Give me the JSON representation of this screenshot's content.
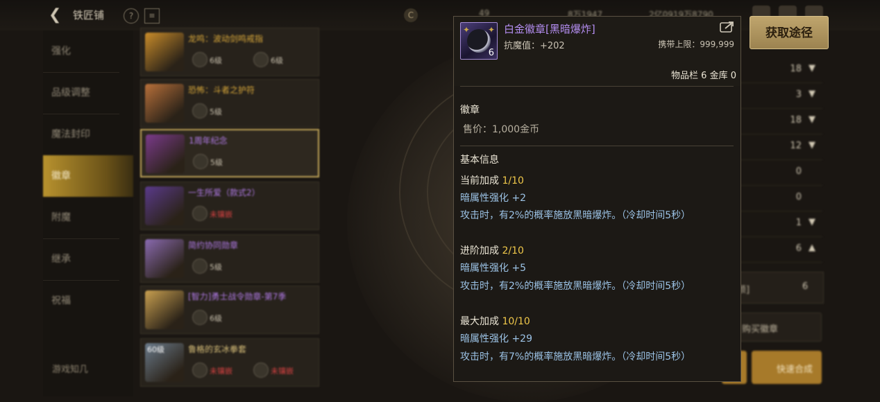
{
  "topbar": {
    "title": "铁匠铺",
    "resources": [
      "49",
      "8万1947",
      "2亿0919万8790"
    ]
  },
  "nav": {
    "items": [
      "强化",
      "品级调整",
      "魔法封印",
      "徽章",
      "附魔",
      "继承",
      "祝福"
    ],
    "active_index": 3,
    "footer_label": "游戏知几"
  },
  "items": [
    {
      "name": "龙鸣：波动剑鸣戒指",
      "badges": [
        "6级",
        "6级"
      ],
      "name_color": "#d9a83a",
      "thumb": "#c98c2a"
    },
    {
      "name": "恐怖：斗者之护符",
      "badges": [
        "5级"
      ],
      "name_color": "#d9a83a",
      "thumb": "#b8703a"
    },
    {
      "name": "1周年纪念",
      "badges": [
        "5级"
      ],
      "name_color": "#b07ae6",
      "thumb": "#7a3a8a"
    },
    {
      "name": "一生所爱（款式2）",
      "badges": [
        "未镶嵌"
      ],
      "name_color": "#b07ae6",
      "thumb": "#5a3a8a"
    },
    {
      "name": "简约协同勋章",
      "badges": [
        "5级"
      ],
      "name_color": "#b07ae6",
      "thumb": "#8a6ab0"
    },
    {
      "name": "[智力]勇士战令勋章-第7季",
      "badges": [
        "6级"
      ],
      "name_color": "#b07ae6",
      "thumb": "#c9a050"
    },
    {
      "name": "鲁格的玄冰拳套",
      "badges": [
        "未镶嵌",
        "未镶嵌"
      ],
      "name_color": "#d9c07a",
      "thumb": "#6a7a8a",
      "level": "60级"
    }
  ],
  "right_panel": {
    "rows": [
      {
        "value": "18",
        "chev": "down"
      },
      {
        "value": "3",
        "chev": "down"
      },
      {
        "value": "18",
        "chev": "down"
      },
      {
        "value": "12",
        "chev": "down"
      },
      {
        "value": "0",
        "chev": ""
      },
      {
        "value": "0",
        "chev": ""
      },
      {
        "value": "1",
        "chev": "down"
      },
      {
        "value": "6",
        "chev": "up"
      }
    ],
    "box_label": "颜]",
    "box_value": "6",
    "buy_label": "购买徽章",
    "quick_label": "快速合成"
  },
  "tooltip": {
    "name": "白金徽章[黑暗爆炸]",
    "count": "6",
    "resist": "抗魔值：+202",
    "carry": "携带上限：999,999",
    "storage": "物品栏 6 金库 0",
    "category": "徽章",
    "price": "售价：1,000金币",
    "basic_info": "基本信息",
    "tiers": [
      {
        "label": "当前加成",
        "level": "1/10",
        "stat": "暗属性强化 +2",
        "effect": "攻击时，有2%的概率施放黑暗爆炸。（冷却时间5秒）"
      },
      {
        "label": "进阶加成",
        "level": "2/10",
        "stat": "暗属性强化 +5",
        "effect": "攻击时，有2%的概率施放黑暗爆炸。（冷却时间5秒）"
      },
      {
        "label": "最大加成",
        "level": "10/10",
        "stat": "暗属性强化 +29",
        "effect": "攻击时，有7%的概率施放黑暗爆炸。（冷却时间5秒）"
      }
    ]
  },
  "get_button": "获取途径",
  "colors": {
    "accent_gold": "#c4a85b",
    "name_purple": "#b58ef2",
    "value_gold": "#f0c84a",
    "effect_blue": "#9cc3e6"
  }
}
